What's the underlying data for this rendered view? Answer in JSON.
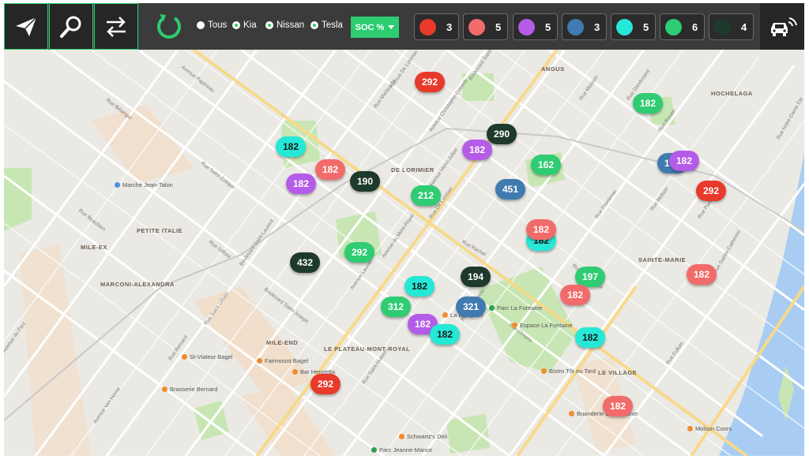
{
  "toolbar": {
    "buttons": [
      {
        "name": "send-button",
        "icon": "paper-plane-icon"
      },
      {
        "name": "search-button",
        "icon": "search-icon"
      },
      {
        "name": "swap-button",
        "icon": "swap-arrows-icon"
      }
    ],
    "refresh_icon": "refresh-icon",
    "filters": [
      {
        "label": "Tous",
        "checked": false
      },
      {
        "label": "Kia",
        "checked": true
      },
      {
        "label": "Nissan",
        "checked": true
      },
      {
        "label": "Tesla",
        "checked": true
      }
    ],
    "soc_label": "SOC %",
    "legend": [
      {
        "color": "#e8392a",
        "count": "3"
      },
      {
        "color": "#f26b6b",
        "count": "5"
      },
      {
        "color": "#b45ce8",
        "count": "5"
      },
      {
        "color": "#3f7bb0",
        "count": "3"
      },
      {
        "color": "#26e8d6",
        "count": "5"
      },
      {
        "color": "#2fcc73",
        "count": "6"
      },
      {
        "color": "#1e3a2c",
        "count": "4"
      }
    ],
    "car_icon": "car-connected-icon"
  },
  "map": {
    "neighborhoods": [
      "ANGUS",
      "HOCHELAGA",
      "DE LORIMIER",
      "PETITE ITALIE",
      "MILE-EX",
      "MARCONI-ALEXANDRA",
      "SAINTE-MARIE",
      "MILE-END",
      "LE PLATEAU-MONT-ROYAL",
      "LE VILLAGE"
    ],
    "streets": [
      "Avenue Papineau",
      "Boulevard Saint-Laurent",
      "Rue Ontario",
      "Rue Sherbrooke",
      "Avenue du Mont-Royal",
      "Rue De Lorimier",
      "Rue Rachel",
      "Avenue Laurier",
      "Boulevard Saint-Joseph",
      "Rue Saint-Denis",
      "Rue Saint-Hubert",
      "Rue Beaubien",
      "Rue Bélanger",
      "Rue Saint-Zotique",
      "Avenue Christophe-Colomb",
      "Rue Fullum",
      "Rue Notre-Dame Est",
      "Rue Sainte-Catherine",
      "Rue Saint-Urbain",
      "Avenue du Parc",
      "Avenue Van Horne",
      "Rue Bernard",
      "Rue Gilford",
      "Avenue Henri-Julien",
      "Rue Dandurand",
      "Rue Molson",
      "Rue Frontenac",
      "Rue Parthenais",
      "Avenue De Lorimier",
      "Rue Marquette",
      "Boulevard Saint-Michel",
      "Rue Rouen",
      "Rue Masson"
    ],
    "pois": [
      {
        "label": "Marché Jean-Talon",
        "color": "#4a90e2"
      },
      {
        "label": "St-Viateur Bagel",
        "color": "#f08c2e"
      },
      {
        "label": "Fairmount Bagel",
        "color": "#f08c2e"
      },
      {
        "label": "Bar Henrietta",
        "color": "#f08c2e"
      },
      {
        "label": "Brasserie Bernard",
        "color": "#f08c2e"
      },
      {
        "label": "Espace La Fontaine",
        "color": "#f08c2e"
      },
      {
        "label": "Bistro Tôt ou Tard",
        "color": "#f08c2e"
      },
      {
        "label": "Buanderie Deo Volente",
        "color": "#f08c2e"
      },
      {
        "label": "Schwartz's Deli",
        "color": "#f08c2e"
      },
      {
        "label": "Molson Coors",
        "color": "#f08c2e"
      },
      {
        "label": "La Banquise",
        "color": "#f08c2e"
      },
      {
        "label": "Parc La Fontaine",
        "color": "#2e9e4f"
      },
      {
        "label": "Parc Jeanne-Mance",
        "color": "#2e9e4f"
      }
    ],
    "markers": [
      {
        "value": "292",
        "color": "#e8392a"
      },
      {
        "value": "182",
        "color": "#2fcc73"
      },
      {
        "value": "290",
        "color": "#1e3a2c"
      },
      {
        "value": "182",
        "color": "#26e8d6"
      },
      {
        "value": "182",
        "color": "#b45ce8"
      },
      {
        "value": "182",
        "color": "#f26b6b"
      },
      {
        "value": "162",
        "color": "#2fcc73"
      },
      {
        "value": "182",
        "color": "#3f7bb0"
      },
      {
        "value": "182",
        "color": "#b45ce8"
      },
      {
        "value": "190",
        "color": "#1e3a2c"
      },
      {
        "value": "182",
        "color": "#b45ce8"
      },
      {
        "value": "212",
        "color": "#2fcc73"
      },
      {
        "value": "451",
        "color": "#3f7bb0"
      },
      {
        "value": "292",
        "color": "#e8392a"
      },
      {
        "value": "182",
        "color": "#26e8d6"
      },
      {
        "value": "182",
        "color": "#f26b6b"
      },
      {
        "value": "292",
        "color": "#2fcc73"
      },
      {
        "value": "432",
        "color": "#1e3a2c"
      },
      {
        "value": "182",
        "color": "#f26b6b"
      },
      {
        "value": "194",
        "color": "#1e3a2c"
      },
      {
        "value": "197",
        "color": "#2fcc73"
      },
      {
        "value": "182",
        "color": "#26e8d6"
      },
      {
        "value": "182",
        "color": "#f26b6b"
      },
      {
        "value": "312",
        "color": "#2fcc73"
      },
      {
        "value": "321",
        "color": "#3f7bb0"
      },
      {
        "value": "182",
        "color": "#b45ce8"
      },
      {
        "value": "182",
        "color": "#26e8d6"
      },
      {
        "value": "182",
        "color": "#26e8d6"
      },
      {
        "value": "292",
        "color": "#e8392a"
      },
      {
        "value": "182",
        "color": "#f26b6b"
      }
    ]
  }
}
